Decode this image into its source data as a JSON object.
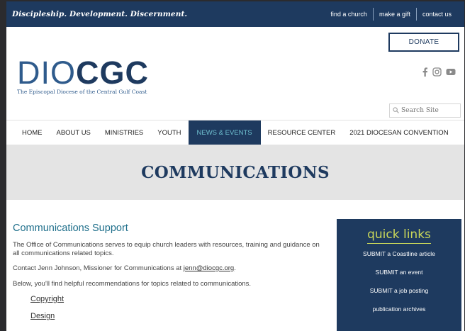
{
  "topbar": {
    "tagline": "Discipleship. Development. Discernment.",
    "links": [
      "find a church",
      "make a gift",
      "contact us"
    ]
  },
  "header": {
    "donate_label": "DONATE",
    "logo": {
      "part1": "DIO",
      "part2": "CGC",
      "subtitle": "The Episcopal Diocese of the Central Gulf Coast"
    },
    "social_icons": [
      "facebook-icon",
      "instagram-icon",
      "youtube-icon"
    ],
    "search_placeholder": "Search Site"
  },
  "nav": {
    "items": [
      "HOME",
      "ABOUT US",
      "MINISTRIES",
      "YOUTH",
      "NEWS & EVENTS",
      "RESOURCE CENTER",
      "2021 DIOCESAN CONVENTION"
    ],
    "active_index": 4
  },
  "page": {
    "title": "COMMUNICATIONS"
  },
  "content": {
    "heading": "Communications Support",
    "para1": "The Office of Communications serves to equip church leaders with resources, training and guidance on all communications related topics.",
    "para2_prefix": "Contact Jenn Johnson, Missioner for Communications at ",
    "email": "jenn@diocgc.org",
    "para2_suffix": ".",
    "para3": "Below, you'll find helpful recommendations for topics related to communications.",
    "sublinks": [
      "Copyright",
      "Design"
    ]
  },
  "quick_links": {
    "title": "quick links",
    "items": [
      "SUBMIT a Coastline article",
      "SUBMIT an event",
      "SUBMIT a job posting",
      "publication archives"
    ]
  },
  "colors": {
    "navy": "#1e3a5f",
    "accent_teal": "#6fc0d0",
    "quick_title": "#c9d75a",
    "heading_teal": "#1f6f8b"
  }
}
